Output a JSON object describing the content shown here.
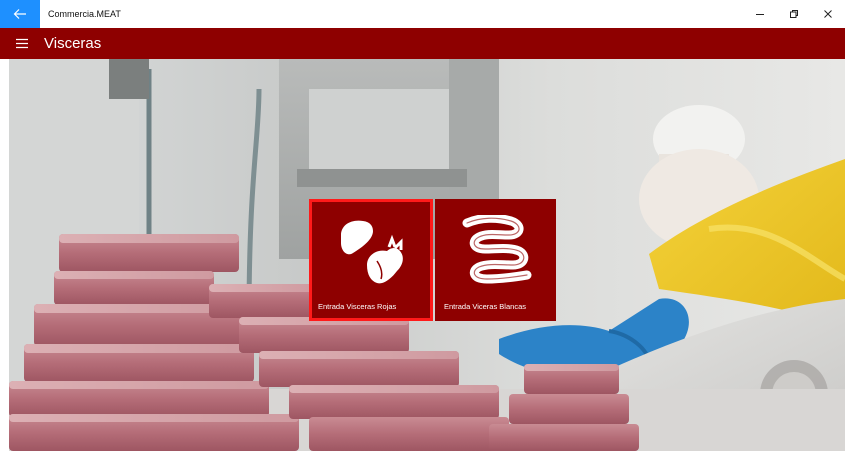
{
  "window": {
    "title": "Commercia.MEAT"
  },
  "appbar": {
    "title": "Visceras"
  },
  "tiles": [
    {
      "label": "Entrada Visceras Rojas",
      "icon": "organs-icon",
      "selected": true
    },
    {
      "label": "Entrada Viceras Blancas",
      "icon": "intestine-icon",
      "selected": false
    }
  ],
  "colors": {
    "accent": "#8e0000",
    "back_button": "#1e90ff",
    "selection_border": "#ff1a1a"
  }
}
